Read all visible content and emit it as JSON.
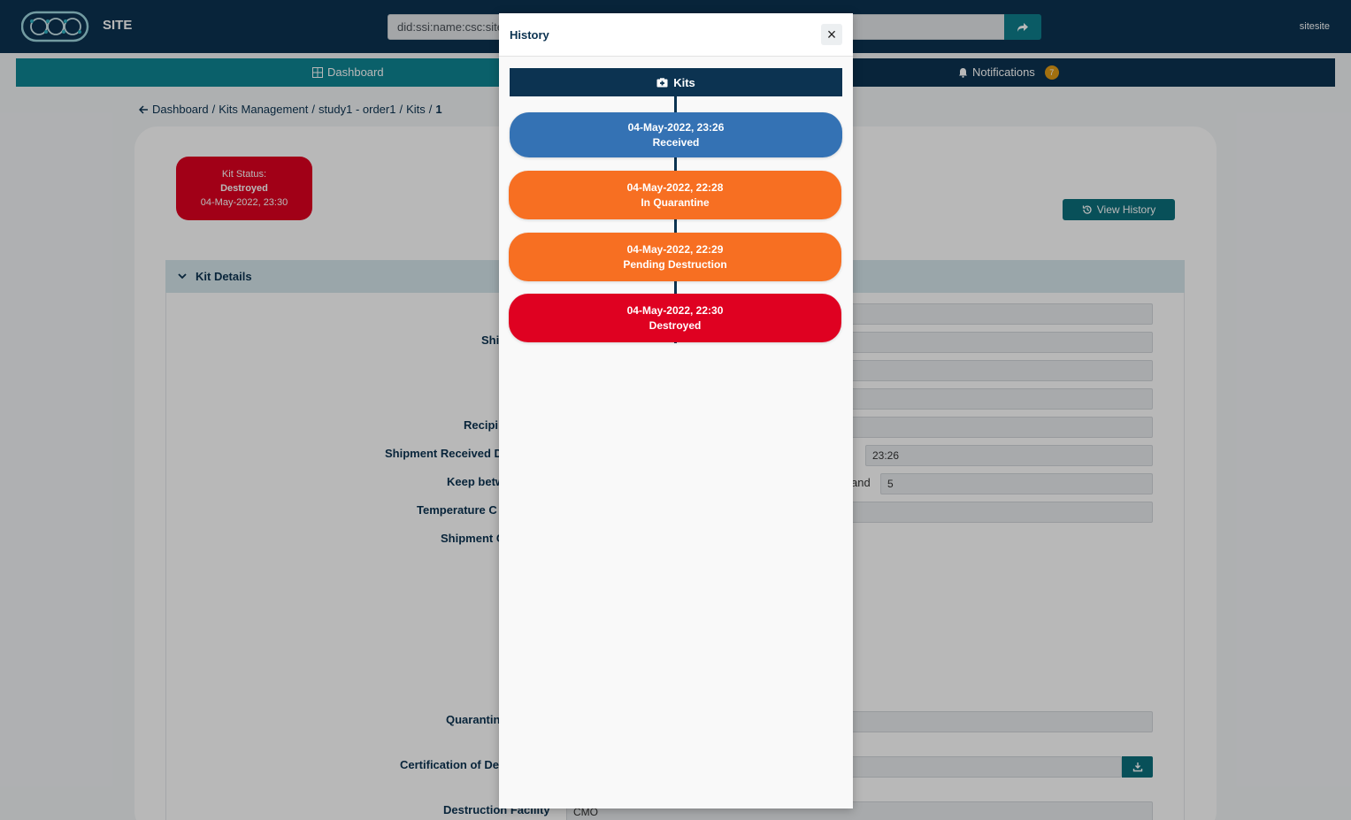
{
  "header": {
    "site_title": "SITE",
    "did_value": "did:ssi:name:csc:site",
    "username": "sitesite"
  },
  "nav": {
    "dashboard_label": "Dashboard",
    "notifications_label": "Notifications",
    "notifications_count": "7"
  },
  "breadcrumb": {
    "items": [
      "Dashboard",
      "Kits Management",
      "study1 - order1",
      "Kits",
      "1"
    ]
  },
  "kit_status": {
    "label": "Kit Status:",
    "value": "Destroyed",
    "date": "04-May-2022, 23:30",
    "color": "#df0121"
  },
  "view_history_label": "View History",
  "kit_details": {
    "section_title": "Kit Details",
    "labels": {
      "shipment": "Shi",
      "recipient": "Recipi",
      "shipment_received": "Shipment Received D",
      "keep_between": "Keep betw",
      "temperature": "Temperature C",
      "shipment_c": "Shipment C",
      "quarantine": "Quarantin",
      "certification": "Certification of De",
      "destruction_facility": "Destruction Facility"
    },
    "fields": {
      "received_time": "23:26",
      "keep_and": "and",
      "keep_max": "5",
      "destruction_facility": "CMO"
    }
  },
  "modal": {
    "title": "History",
    "close_glyph": "×",
    "timeline_header": "Kits",
    "events": [
      {
        "date": "04-May-2022, 23:26",
        "status": "Received",
        "color": "#3472b4"
      },
      {
        "date": "04-May-2022, 22:28",
        "status": "In Quarantine",
        "color": "#f76f22"
      },
      {
        "date": "04-May-2022, 22:29",
        "status": "Pending Destruction",
        "color": "#f76f22"
      },
      {
        "date": "04-May-2022, 22:30",
        "status": "Destroyed",
        "color": "#df0121"
      }
    ]
  }
}
